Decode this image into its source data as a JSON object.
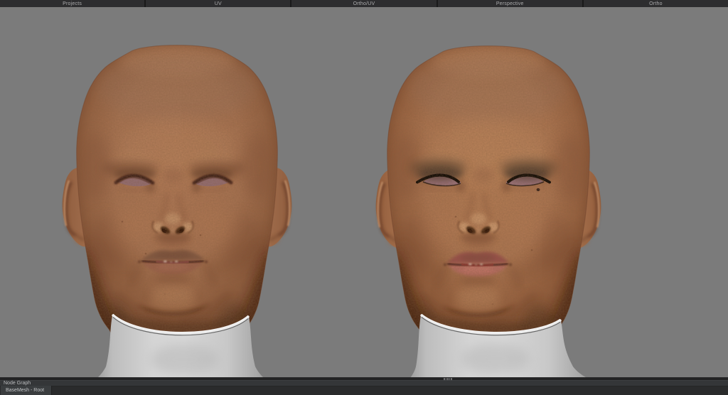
{
  "viewport_tabs": {
    "items": [
      "Projects",
      "UV",
      "Ortho/UV",
      "Perspective",
      "Ortho"
    ]
  },
  "node_graph": {
    "header": "Node Graph",
    "active_tab": "BaseMesh - Root"
  },
  "colors": {
    "viewport_background": "#7b7b7b",
    "panel_dark": "#232324",
    "tab_bar": "#2d2d2f",
    "skin_left": "#a87351",
    "skin_right": "#ad7550",
    "collar": "#d5d5d5"
  }
}
